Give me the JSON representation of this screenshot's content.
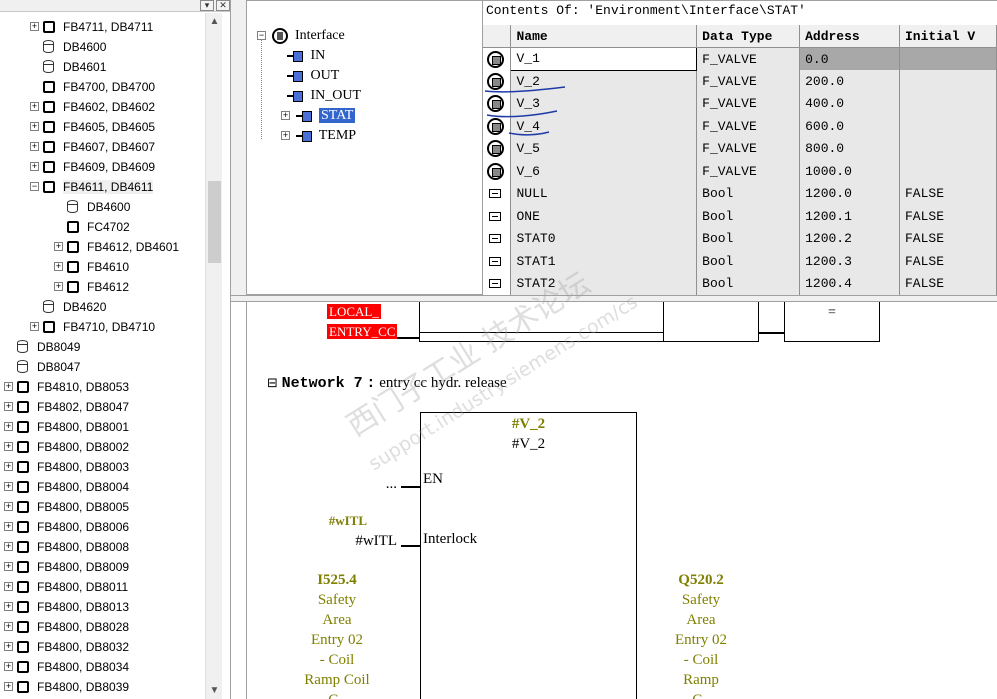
{
  "block_tree": {
    "items": [
      {
        "label": "FB4711, DB4711",
        "type": "fb",
        "expander": "+",
        "level": 1
      },
      {
        "label": "DB4600",
        "type": "db",
        "expander": "",
        "level": 1
      },
      {
        "label": "DB4601",
        "type": "db",
        "expander": "",
        "level": 1
      },
      {
        "label": "FB4700, DB4700",
        "type": "fb",
        "expander": "",
        "level": 1
      },
      {
        "label": "FB4602, DB4602",
        "type": "fb",
        "expander": "+",
        "level": 1
      },
      {
        "label": "FB4605, DB4605",
        "type": "fb",
        "expander": "+",
        "level": 1
      },
      {
        "label": "FB4607, DB4607",
        "type": "fb",
        "expander": "+",
        "level": 1
      },
      {
        "label": "FB4609, DB4609",
        "type": "fb",
        "expander": "+",
        "level": 1
      },
      {
        "label": "FB4611, DB4611",
        "type": "fb",
        "expander": "-",
        "level": 1,
        "selected": true
      },
      {
        "label": "DB4600",
        "type": "db",
        "expander": "",
        "level": 2
      },
      {
        "label": "FC4702",
        "type": "fb",
        "expander": "",
        "level": 2
      },
      {
        "label": "FB4612, DB4601",
        "type": "fb",
        "expander": "+",
        "level": 2
      },
      {
        "label": "FB4610",
        "type": "fb",
        "expander": "+",
        "level": 2
      },
      {
        "label": "FB4612",
        "type": "fb",
        "expander": "+",
        "level": 2
      },
      {
        "label": "DB4620",
        "type": "db",
        "expander": "",
        "level": 1
      },
      {
        "label": "FB4710, DB4710",
        "type": "fb",
        "expander": "+",
        "level": 1
      },
      {
        "label": "DB8049",
        "type": "db",
        "expander": "",
        "level": 0
      },
      {
        "label": "DB8047",
        "type": "db",
        "expander": "",
        "level": 0
      },
      {
        "label": "FB4810, DB8053",
        "type": "fb",
        "expander": "+",
        "level": 0
      },
      {
        "label": "FB4802, DB8047",
        "type": "fb",
        "expander": "+",
        "level": 0
      },
      {
        "label": "FB4800, DB8001",
        "type": "fb",
        "expander": "+",
        "level": 0
      },
      {
        "label": "FB4800, DB8002",
        "type": "fb",
        "expander": "+",
        "level": 0
      },
      {
        "label": "FB4800, DB8003",
        "type": "fb",
        "expander": "+",
        "level": 0
      },
      {
        "label": "FB4800, DB8004",
        "type": "fb",
        "expander": "+",
        "level": 0
      },
      {
        "label": "FB4800, DB8005",
        "type": "fb",
        "expander": "+",
        "level": 0
      },
      {
        "label": "FB4800, DB8006",
        "type": "fb",
        "expander": "+",
        "level": 0
      },
      {
        "label": "FB4800, DB8008",
        "type": "fb",
        "expander": "+",
        "level": 0
      },
      {
        "label": "FB4800, DB8009",
        "type": "fb",
        "expander": "+",
        "level": 0
      },
      {
        "label": "FB4800, DB8011",
        "type": "fb",
        "expander": "+",
        "level": 0
      },
      {
        "label": "FB4800, DB8013",
        "type": "fb",
        "expander": "+",
        "level": 0
      },
      {
        "label": "FB4800, DB8028",
        "type": "fb",
        "expander": "+",
        "level": 0
      },
      {
        "label": "FB4800, DB8032",
        "type": "fb",
        "expander": "+",
        "level": 0
      },
      {
        "label": "FB4800, DB8034",
        "type": "fb",
        "expander": "+",
        "level": 0
      },
      {
        "label": "FB4800, DB8039",
        "type": "fb",
        "expander": "+",
        "level": 0
      }
    ]
  },
  "interface_tree": {
    "root": "Interface",
    "children": [
      "IN",
      "OUT",
      "IN_OUT",
      "STAT",
      "TEMP"
    ],
    "selected": "STAT"
  },
  "contents": {
    "title": "Contents Of: 'Environment\\Interface\\STAT'",
    "columns": [
      "Name",
      "Data Type",
      "Address",
      "Initial V"
    ],
    "rows": [
      {
        "icon": "fb-instance",
        "name": "V_1",
        "type": "F_VALVE",
        "address": "0.0",
        "initial": ""
      },
      {
        "icon": "fb-instance",
        "name": "V_2",
        "type": "F_VALVE",
        "address": "200.0",
        "initial": ""
      },
      {
        "icon": "fb-instance",
        "name": "V_3",
        "type": "F_VALVE",
        "address": "400.0",
        "initial": ""
      },
      {
        "icon": "fb-instance",
        "name": "V_4",
        "type": "F_VALVE",
        "address": "600.0",
        "initial": ""
      },
      {
        "icon": "fb-instance",
        "name": "V_5",
        "type": "F_VALVE",
        "address": "800.0",
        "initial": ""
      },
      {
        "icon": "fb-instance",
        "name": "V_6",
        "type": "F_VALVE",
        "address": "1000.0",
        "initial": ""
      },
      {
        "icon": "bool",
        "name": "NULL",
        "type": "Bool",
        "address": "1200.0",
        "initial": "FALSE"
      },
      {
        "icon": "bool",
        "name": "ONE",
        "type": "Bool",
        "address": "1200.1",
        "initial": "FALSE"
      },
      {
        "icon": "bool",
        "name": "STAT0",
        "type": "Bool",
        "address": "1200.2",
        "initial": "FALSE"
      },
      {
        "icon": "bool",
        "name": "STAT1",
        "type": "Bool",
        "address": "1200.3",
        "initial": "FALSE"
      },
      {
        "icon": "bool",
        "name": "STAT2",
        "type": "Bool",
        "address": "1200.4",
        "initial": "FALSE"
      }
    ]
  },
  "code": {
    "prev_network": {
      "red_labels": [
        "LOCAL_",
        "ENTRY_CC"
      ],
      "box_symbol": "="
    },
    "network": {
      "collapse_symbol": "⊟",
      "label": "Network 7",
      "separator": ":",
      "comment": "entry cc hydr. release",
      "block_instance": "#V_2",
      "block_type": "#V_2",
      "en_input": "...",
      "pin_en": "EN",
      "pin_interlock": "Interlock",
      "interlock_symbol": "#wITL",
      "interlock_actual": "#wITL",
      "left_address": "I525.4",
      "left_comment": [
        "Safety",
        "Area",
        "Entry 02",
        "- Coil",
        "Ramp Coil",
        "C.."
      ],
      "right_address": "Q520.2",
      "right_comment": [
        "Safety",
        "Area",
        "Entry 02",
        "- Coil",
        "Ramp",
        "C.."
      ]
    }
  },
  "watermark": {
    "text_cn": "西门子工业 技术论坛",
    "text_url": "support.industry.siemens.com/cs"
  },
  "colors": {
    "selection": "#3366cc",
    "red_label": "#ff0000",
    "olive": "#7f7f00",
    "pen_annotation": "#1e3aa8"
  }
}
